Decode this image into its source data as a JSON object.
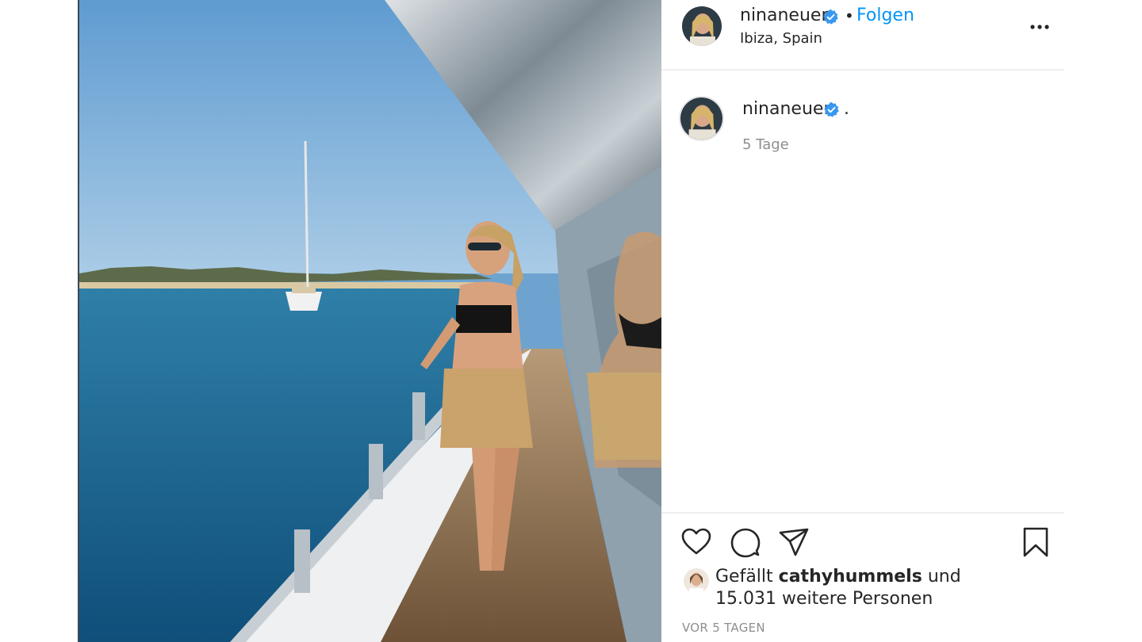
{
  "header": {
    "username": "ninaneuer",
    "separator": "•",
    "follow_label": "Folgen",
    "location": "Ibiza, Spain",
    "more_icon": "more-horizontal-icon"
  },
  "caption": {
    "username": "ninaneuer",
    "text": ".",
    "time": "5 Tage"
  },
  "actions": {
    "like_icon": "heart-icon",
    "comment_icon": "comment-icon",
    "share_icon": "paper-plane-icon",
    "save_icon": "bookmark-icon"
  },
  "likes": {
    "prefix": "Gefällt",
    "liker": "cathyhummels",
    "and": "und",
    "count": "15.031",
    "suffix": "weitere Personen"
  },
  "post_date": "VOR 5 TAGEN",
  "colors": {
    "follow_blue": "#0095f6",
    "verified_blue": "#3897f0",
    "muted_text": "#8e8e8e",
    "divider": "#efefef"
  }
}
